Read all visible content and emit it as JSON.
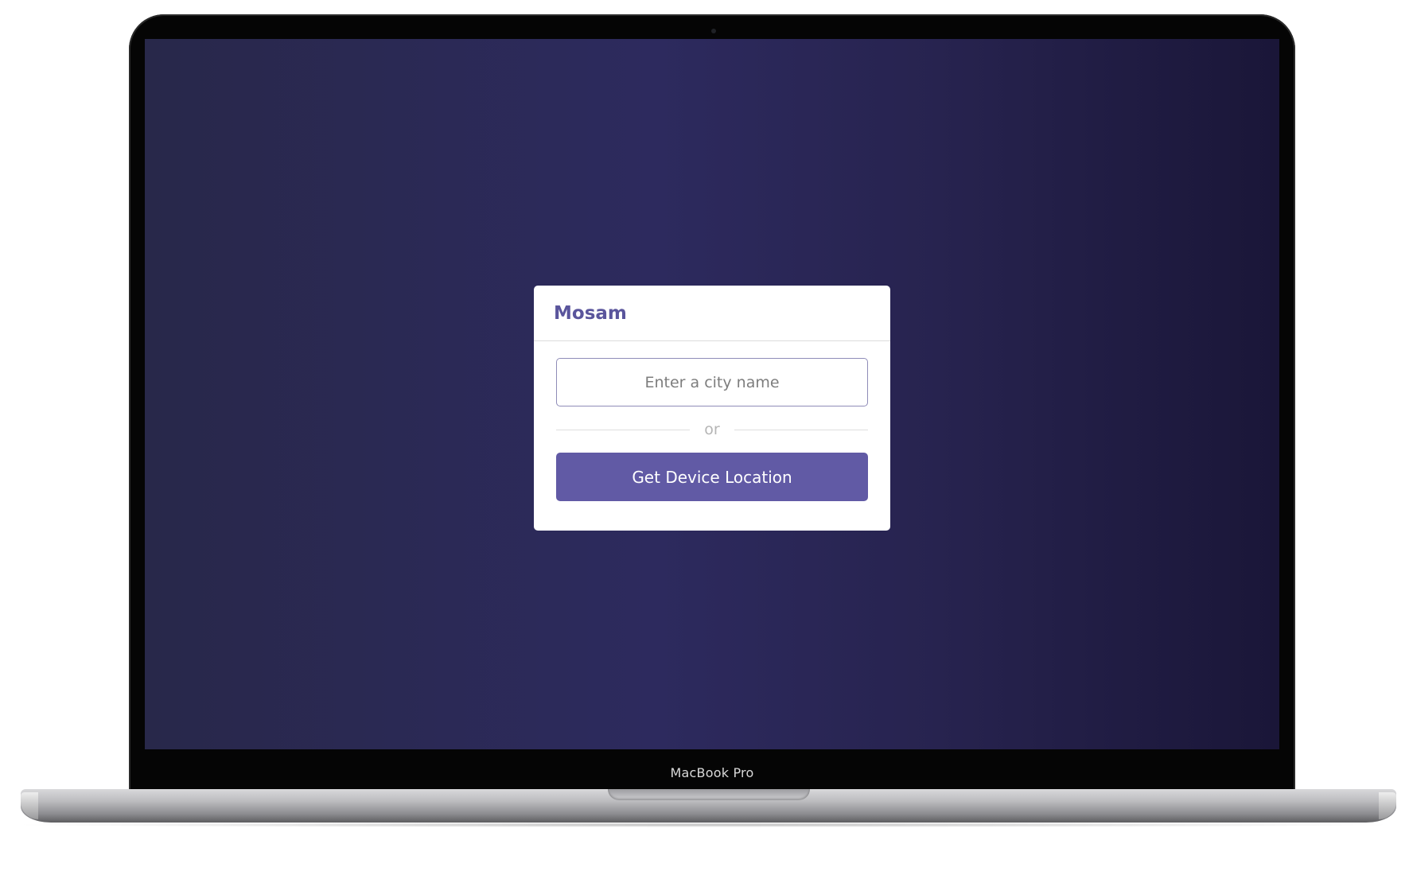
{
  "device": {
    "model_label": "MacBook Pro"
  },
  "app": {
    "title": "Mosam",
    "search": {
      "value": "",
      "placeholder": "Enter a city name"
    },
    "divider_text": "or",
    "location_button_label": "Get Device Location"
  },
  "colors": {
    "brand": "#5a559c",
    "button": "#615aa5",
    "background_start": "#28284a",
    "background_end": "#1a1638"
  }
}
